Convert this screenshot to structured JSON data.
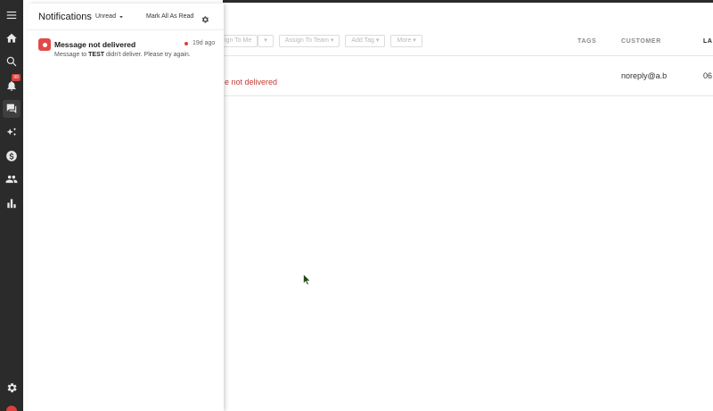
{
  "rail": {
    "icons": [
      "menu-icon",
      "home-icon",
      "search-icon",
      "bell-icon",
      "conversations-icon",
      "sparkle-icon",
      "billing-icon",
      "people-icon",
      "reports-icon",
      "settings-icon"
    ],
    "bell_badge": "99"
  },
  "background": {
    "toolbar": [
      "ign To Me",
      "▾",
      "Assign To Team ▾",
      "Add Tag ▾",
      "More ▾"
    ],
    "columns": {
      "tags": "TAGS",
      "customer": "CUSTOMER",
      "last": "LA"
    },
    "row": {
      "status": "e not delivered",
      "email": "noreply@a.b",
      "date": "06"
    }
  },
  "panel": {
    "title": "Notifications",
    "filter": "Unread",
    "mark_all": "Mark All As Read",
    "items": [
      {
        "title": "Message not delivered",
        "age": "19d ago",
        "msg_prefix": "Message to ",
        "msg_bold": "TEST",
        "msg_suffix": " didn't deliver. Please try again.",
        "accent": "#e24a4a"
      }
    ]
  },
  "colors": {
    "rail_bg": "#2b2b2b",
    "error": "#d8423a",
    "accent_red": "#e24a4a"
  }
}
